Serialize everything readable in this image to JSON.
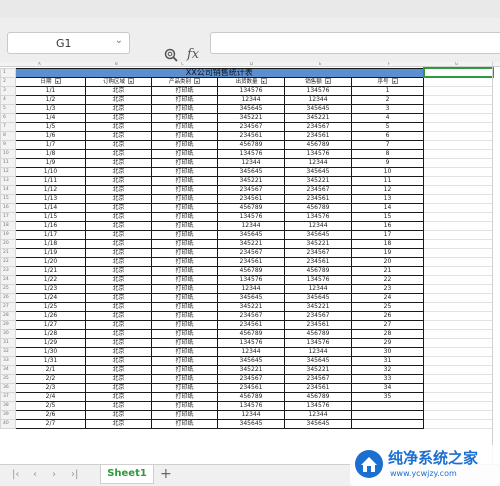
{
  "formula_bar": {
    "cell_ref": "G1",
    "fx_label": "fx",
    "value": ""
  },
  "columns": [
    "A",
    "B",
    "C",
    "D",
    "E",
    "F",
    "G"
  ],
  "sheet": {
    "title": "XX公司销售统计表",
    "headers": [
      "日期",
      "订购区域",
      "产品类别",
      "出货数量",
      "销售额",
      "序号"
    ],
    "rows": [
      [
        "1/1",
        "北京",
        "打印纸",
        "134576",
        "134576",
        "1"
      ],
      [
        "1/2",
        "北京",
        "打印纸",
        "12344",
        "12344",
        "2"
      ],
      [
        "1/3",
        "北京",
        "打印纸",
        "345645",
        "345645",
        "3"
      ],
      [
        "1/4",
        "北京",
        "打印纸",
        "345221",
        "345221",
        "4"
      ],
      [
        "1/5",
        "北京",
        "打印纸",
        "234567",
        "234567",
        "5"
      ],
      [
        "1/6",
        "北京",
        "打印纸",
        "234561",
        "234561",
        "6"
      ],
      [
        "1/7",
        "北京",
        "打印纸",
        "456789",
        "456789",
        "7"
      ],
      [
        "1/8",
        "北京",
        "打印纸",
        "134576",
        "134576",
        "8"
      ],
      [
        "1/9",
        "北京",
        "打印纸",
        "12344",
        "12344",
        "9"
      ],
      [
        "1/10",
        "北京",
        "打印纸",
        "345645",
        "345645",
        "10"
      ],
      [
        "1/11",
        "北京",
        "打印纸",
        "345221",
        "345221",
        "11"
      ],
      [
        "1/12",
        "北京",
        "打印纸",
        "234567",
        "234567",
        "12"
      ],
      [
        "1/13",
        "北京",
        "打印纸",
        "234561",
        "234561",
        "13"
      ],
      [
        "1/14",
        "北京",
        "打印纸",
        "456789",
        "456789",
        "14"
      ],
      [
        "1/15",
        "北京",
        "打印纸",
        "134576",
        "134576",
        "15"
      ],
      [
        "1/16",
        "北京",
        "打印纸",
        "12344",
        "12344",
        "16"
      ],
      [
        "1/17",
        "北京",
        "打印纸",
        "345645",
        "345645",
        "17"
      ],
      [
        "1/18",
        "北京",
        "打印纸",
        "345221",
        "345221",
        "18"
      ],
      [
        "1/19",
        "北京",
        "打印纸",
        "234567",
        "234567",
        "19"
      ],
      [
        "1/20",
        "北京",
        "打印纸",
        "234561",
        "234561",
        "20"
      ],
      [
        "1/21",
        "北京",
        "打印纸",
        "456789",
        "456789",
        "21"
      ],
      [
        "1/22",
        "北京",
        "打印纸",
        "134576",
        "134576",
        "22"
      ],
      [
        "1/23",
        "北京",
        "打印纸",
        "12344",
        "12344",
        "23"
      ],
      [
        "1/24",
        "北京",
        "打印纸",
        "345645",
        "345645",
        "24"
      ],
      [
        "1/25",
        "北京",
        "打印纸",
        "345221",
        "345221",
        "25"
      ],
      [
        "1/26",
        "北京",
        "打印纸",
        "234567",
        "234567",
        "26"
      ],
      [
        "1/27",
        "北京",
        "打印纸",
        "234561",
        "234561",
        "27"
      ],
      [
        "1/28",
        "北京",
        "打印纸",
        "456789",
        "456789",
        "28"
      ],
      [
        "1/29",
        "北京",
        "打印纸",
        "134576",
        "134576",
        "29"
      ],
      [
        "1/30",
        "北京",
        "打印纸",
        "12344",
        "12344",
        "30"
      ],
      [
        "1/31",
        "北京",
        "打印纸",
        "345645",
        "345645",
        "31"
      ],
      [
        "2/1",
        "北京",
        "打印纸",
        "345221",
        "345221",
        "32"
      ],
      [
        "2/2",
        "北京",
        "打印纸",
        "234567",
        "234567",
        "33"
      ],
      [
        "2/3",
        "北京",
        "打印纸",
        "234561",
        "234561",
        "34"
      ],
      [
        "2/4",
        "北京",
        "打印纸",
        "456789",
        "456789",
        "35"
      ],
      [
        "2/5",
        "北京",
        "打印纸",
        "134576",
        "134576",
        ""
      ],
      [
        "2/6",
        "北京",
        "打印纸",
        "12344",
        "12344",
        ""
      ],
      [
        "2/7",
        "北京",
        "打印纸",
        "345645",
        "345645",
        ""
      ]
    ]
  },
  "tabs": {
    "sheets": [
      "Sheet1"
    ],
    "add_label": "+"
  },
  "watermark": {
    "text": "纯净系统之家",
    "url": "www.ycwjzy.com"
  }
}
